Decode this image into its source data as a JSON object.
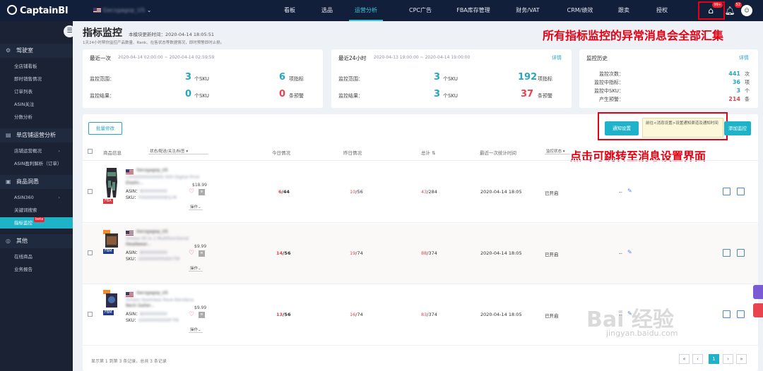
{
  "topbar": {
    "logo": "CaptainBI",
    "store": "Gecsgagop_US",
    "nav": [
      "看板",
      "选品",
      "运营分析",
      "CPC广告",
      "FBA库存管理",
      "财务/VAT",
      "CRM/绩效",
      "跟卖",
      "授权"
    ],
    "active_nav": "运营分析",
    "alert_count": "99+",
    "bell_count": "52"
  },
  "sidebar": {
    "groups": [
      {
        "label": "驾驶室",
        "icon": "gear-icon",
        "items": [
          "全店铺看板",
          "即时销售情况",
          "订单列表",
          "ASIN关注",
          "分数分析"
        ]
      },
      {
        "label": "单店铺运营分析",
        "icon": "store-icon",
        "items": [
          "店铺运营概况",
          "ASIN盈利解析（订单）"
        ]
      },
      {
        "label": "商品洞悉",
        "icon": "goods-icon",
        "items": [
          "ASIN360",
          "关键词搜索",
          "指标监控"
        ]
      },
      {
        "label": "其他",
        "icon": "other-icon",
        "items": [
          "在线商品",
          "业务报告"
        ]
      }
    ],
    "active_item": "指标监控",
    "beta_label": "beta"
  },
  "page": {
    "title": "指标监控",
    "update_label": "本模块更新时间：2020-04-14 18:05:51",
    "subtitle": "1天24小时帮你监控产品数量、Rank、在售状态等数据情况，即时预警即时止损。",
    "annotation_top": "所有指标监控的异常消息会全部汇集",
    "annotation_mid": "点击可跳转至消息设置界面"
  },
  "recent": {
    "title": "最近一次",
    "range": "2020-04-14 02:00:00 ~ 2020-04-14 02:59:59",
    "scope_label": "监控范围：",
    "result_label": "监控结果：",
    "scope_sku": "3",
    "scope_sku_unit": "个SKU",
    "scope_metric": "6",
    "scope_metric_unit": "项指标",
    "result_sku": "0",
    "result_sku_unit": "个SKU",
    "result_alert": "0",
    "result_alert_unit": "条预警"
  },
  "last24": {
    "title": "最近24小时",
    "range": "2020-04-13 19:00:00 ~ 2020-04-14 19:00:00",
    "detail": "详情",
    "scope_label": "监控范围：",
    "result_label": "监控结果：",
    "scope_sku": "3",
    "scope_sku_unit": "个SKU",
    "scope_metric": "192",
    "scope_metric_unit": "项指标",
    "result_sku": "3",
    "result_sku_unit": "个SKU",
    "result_alert": "37",
    "result_alert_unit": "条预警"
  },
  "history": {
    "title": "监控历史",
    "detail": "详情",
    "rows": [
      {
        "label": "监控次数：",
        "value": "441",
        "unit": "次"
      },
      {
        "label": "监控中指标：",
        "value": "36",
        "unit": "项"
      },
      {
        "label": "监控中SKU：",
        "value": "3",
        "unit": "个"
      },
      {
        "label": "产生预警：",
        "value": "214",
        "unit": "条"
      }
    ]
  },
  "toolbar": {
    "batch_edit": "批量修改",
    "notify_btn": "通知设置",
    "tooltip": "前往<消息设置>设置通知渠道及通知时间",
    "add_btn": "添加监控"
  },
  "table": {
    "headers": {
      "product": "商品信息",
      "status_filter": "状态/配送/关注/标签",
      "today": "今日情况",
      "yesterday": "昨日情况",
      "total": "总计",
      "last_time": "最近一次统计时间",
      "monitor_status": "监控状态"
    },
    "rows": [
      {
        "title": "C0000000000000 000 Digital Print",
        "title2": "Elastic...",
        "price": "$18.99",
        "asin_label": "ASIN：",
        "asin": "B000000000",
        "sku_label": "SKU：",
        "sku": "F000000000EQ-M",
        "ship": "FBA",
        "today_a": "6",
        "today_b": "/44",
        "yesterday_a": "10",
        "yesterday_b": "/56",
        "total_a": "43",
        "total_b": "/284",
        "time": "2020-04-14 18:05",
        "status": "已开启",
        "dash": "--",
        "ops": "操作"
      },
      {
        "title": "Unisex 00 in 1 Multifunctional",
        "title2": "Headwear...",
        "price": "$9.99",
        "asin_label": "ASIN：",
        "asin": "B000000000",
        "sku_label": "SKU：",
        "sku": "G00000000VKH-TM",
        "ship": "FBM",
        "today_a": "14",
        "today_b": "/56",
        "yesterday_a": "19",
        "yesterday_b": "/74",
        "total_a": "88",
        "total_b": "/374",
        "time": "2020-04-14 18:05",
        "status": "已开启",
        "dash": "--",
        "ops": "操作"
      },
      {
        "title": "Unisex Seamless Rave Bandana",
        "title2": "Neck Gaiter...",
        "price": "$9.99",
        "asin_label": "ASIN：",
        "asin": "B000000000",
        "sku_label": "SKU：",
        "sku": "G0000000000P-TM",
        "ship": "FBM",
        "today_a": "13",
        "today_b": "/56",
        "yesterday_a": "16",
        "yesterday_b": "/74",
        "total_a": "83",
        "total_b": "/374",
        "time": "2020-04-14 18:05",
        "status": "已开启",
        "dash": "--",
        "ops": "操作"
      }
    ],
    "footer": "显示第 1 到第 3 条记录，总共 3 条记录",
    "page": "1"
  },
  "watermark": {
    "line1": "Bai 经验",
    "line2": "jingyan.baidu.com"
  },
  "colors": {
    "accent": "#27a6c1",
    "nav_bg": "#121f3a",
    "sidebar_bg": "#1a2233",
    "alert_red": "#e60012"
  }
}
